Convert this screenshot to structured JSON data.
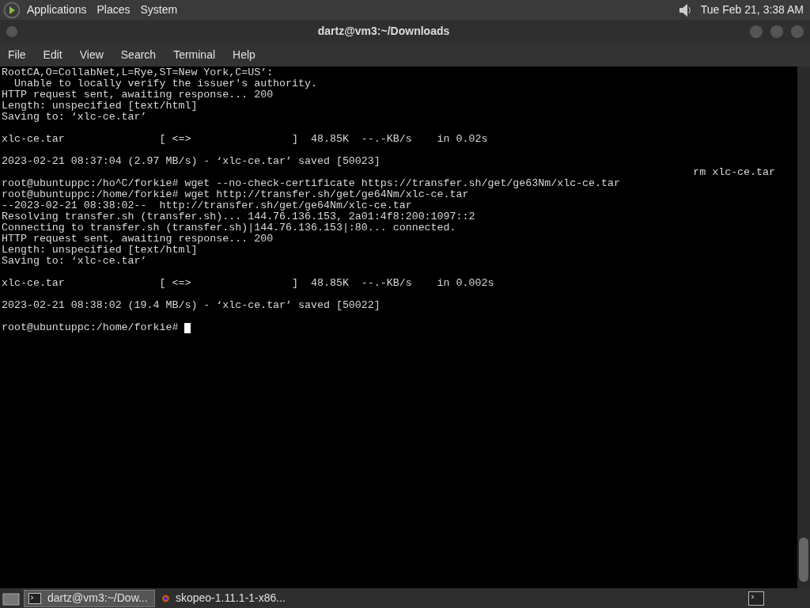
{
  "top_panel": {
    "menus": [
      "Applications",
      "Places",
      "System"
    ],
    "clock": "Tue Feb 21, 3:38 AM"
  },
  "window": {
    "title": "dartz@vm3:~/Downloads"
  },
  "menubar": [
    "File",
    "Edit",
    "View",
    "Search",
    "Terminal",
    "Help"
  ],
  "terminal": {
    "lines": [
      {
        "kind": "text",
        "text": "RootCA,O=CollabNet,L=Rye,ST=New York,C=US’:"
      },
      {
        "kind": "text",
        "text": "  Unable to locally verify the issuer's authority."
      },
      {
        "kind": "text",
        "text": "HTTP request sent, awaiting response... 200"
      },
      {
        "kind": "text",
        "text": "Length: unspecified [text/html]"
      },
      {
        "kind": "text",
        "text": "Saving to: ‘xlc-ce.tar’"
      },
      {
        "kind": "blank"
      },
      {
        "kind": "text",
        "text": "xlc-ce.tar               [ <=>                ]  48.85K  --.-KB/s    in 0.02s"
      },
      {
        "kind": "blank"
      },
      {
        "kind": "text",
        "text": "2023-02-21 08:37:04 (2.97 MB/s) - ‘xlc-ce.tar’ saved [50023]"
      },
      {
        "kind": "right",
        "text": "rm xlc-ce.tar"
      },
      {
        "kind": "text",
        "text": "root@ubuntuppc:/ho^C/forkie# wget --no-check-certificate https://transfer.sh/get/ge63Nm/xlc-ce.tar"
      },
      {
        "kind": "text",
        "text": "root@ubuntuppc:/home/forkie# wget http://transfer.sh/get/ge64Nm/xlc-ce.tar"
      },
      {
        "kind": "text",
        "text": "--2023-02-21 08:38:02--  http://transfer.sh/get/ge64Nm/xlc-ce.tar"
      },
      {
        "kind": "text",
        "text": "Resolving transfer.sh (transfer.sh)... 144.76.136.153, 2a01:4f8:200:1097::2"
      },
      {
        "kind": "text",
        "text": "Connecting to transfer.sh (transfer.sh)|144.76.136.153|:80... connected."
      },
      {
        "kind": "text",
        "text": "HTTP request sent, awaiting response... 200"
      },
      {
        "kind": "text",
        "text": "Length: unspecified [text/html]"
      },
      {
        "kind": "text",
        "text": "Saving to: ‘xlc-ce.tar’"
      },
      {
        "kind": "blank"
      },
      {
        "kind": "text",
        "text": "xlc-ce.tar               [ <=>                ]  48.85K  --.-KB/s    in 0.002s"
      },
      {
        "kind": "blank"
      },
      {
        "kind": "text",
        "text": "2023-02-21 08:38:02 (19.4 MB/s) - ‘xlc-ce.tar’ saved [50022]"
      },
      {
        "kind": "blank"
      },
      {
        "kind": "prompt",
        "text": "root@ubuntuppc:/home/forkie# "
      }
    ]
  },
  "taskbar": {
    "items": [
      {
        "kind": "terminal",
        "label": "dartz@vm3:~/Dow...",
        "selected": true
      },
      {
        "kind": "browser",
        "label": "skopeo-1.11.1-1-x86...",
        "selected": false
      }
    ]
  }
}
